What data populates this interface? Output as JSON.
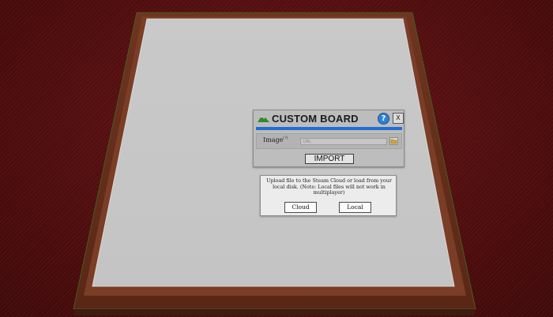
{
  "dialog": {
    "title": "CUSTOM BOARD",
    "help_symbol": "?",
    "close_symbol": "X",
    "image_label": "Image",
    "image_hint": "(?)",
    "url_placeholder": "URL",
    "import_label": "IMPORT",
    "icons": [
      "mountain-icon",
      "help-icon",
      "close-icon",
      "folder-icon"
    ]
  },
  "upload_popup": {
    "message": "Upload file to the Steam Cloud or load from your local disk. (Note: Local files will not work in multiplayer)",
    "cloud_label": "Cloud",
    "local_label": "Local"
  },
  "colors": {
    "table_felt": "#5a0f10",
    "board_surface": "#c8c8c8",
    "board_frame": "#6b3320",
    "accent_blue": "#1f6ed4"
  }
}
